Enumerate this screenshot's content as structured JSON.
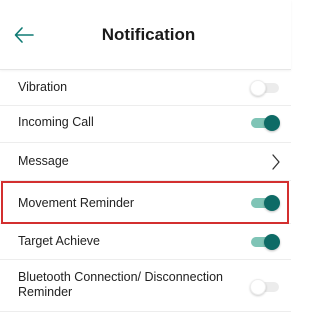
{
  "header": {
    "title": "Notification",
    "back_icon": "arrow-left-icon"
  },
  "settings": [
    {
      "label": "Vibration",
      "control": "toggle",
      "on": false
    },
    {
      "label": "Incoming Call",
      "control": "toggle",
      "on": true
    },
    {
      "label": "Message",
      "control": "chevron"
    },
    {
      "label": "Movement Reminder",
      "control": "toggle",
      "on": true,
      "highlighted": true
    },
    {
      "label": "Target Achieve",
      "control": "toggle",
      "on": true
    },
    {
      "label": "Bluetooth Connection/ Disconnection Reminder",
      "control": "toggle",
      "on": false
    }
  ],
  "colors": {
    "toggle_on_knob": "#0e6b66",
    "toggle_on_track": "#7fc4b6",
    "toggle_off_track": "#ececec",
    "highlight_border": "#d32f2f",
    "back_icon": "#0e7a73"
  }
}
